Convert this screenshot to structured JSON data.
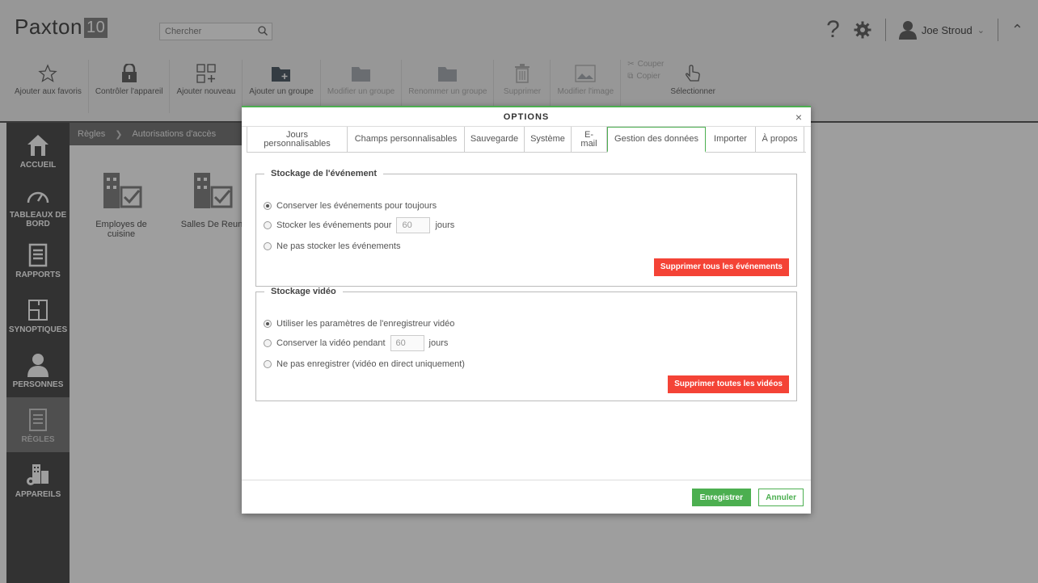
{
  "header": {
    "logo_text": "Paxton",
    "logo_number": "10",
    "search_placeholder": "Chercher",
    "user_name": "Joe Stroud"
  },
  "toolbar": {
    "items": [
      {
        "label": "Ajouter aux favoris",
        "icon": "star-icon",
        "enabled": true
      },
      {
        "label": "Contrôler l'appareil",
        "icon": "lock-icon",
        "enabled": true
      },
      {
        "label": "Ajouter nouveau",
        "icon": "add-grid-icon",
        "enabled": true
      },
      {
        "label": "Ajouter un groupe",
        "icon": "add-folder-icon",
        "enabled": true
      },
      {
        "label": "Modifier un groupe",
        "icon": "edit-folder-icon",
        "enabled": false
      },
      {
        "label": "Renommer un groupe",
        "icon": "rename-folder-icon",
        "enabled": false
      },
      {
        "label": "Supprimer",
        "icon": "trash-icon",
        "enabled": false
      },
      {
        "label": "Modifier l'image",
        "icon": "image-icon",
        "enabled": false
      }
    ],
    "cut_label": "Couper",
    "copy_label": "Copier",
    "select_label": "Sélectionner"
  },
  "sidebar": {
    "items": [
      {
        "label": "ACCUEIL",
        "icon": "home-icon"
      },
      {
        "label": "TABLEAUX DE BORD",
        "icon": "dashboard-icon"
      },
      {
        "label": "RAPPORTS",
        "icon": "reports-icon"
      },
      {
        "label": "SYNOPTIQUES",
        "icon": "floorplan-icon"
      },
      {
        "label": "PERSONNES",
        "icon": "person-icon"
      },
      {
        "label": "RÈGLES",
        "icon": "rules-icon",
        "active": true
      },
      {
        "label": "APPAREILS",
        "icon": "devices-icon"
      }
    ]
  },
  "content": {
    "breadcrumb": [
      "Règles",
      "Autorisations d'accès"
    ],
    "tiles": [
      "Employes de cuisine",
      "Salles De Reun"
    ]
  },
  "dialog": {
    "title": "OPTIONS",
    "close": "×",
    "tabs": [
      {
        "label": "Jours personnalisables",
        "active": false
      },
      {
        "label": "Champs personnalisables",
        "active": false
      },
      {
        "label": "Sauvegarde",
        "active": false
      },
      {
        "label": "Système",
        "active": false
      },
      {
        "label": "E-mail",
        "active": false
      },
      {
        "label": "Gestion des données",
        "active": true
      },
      {
        "label": "Importer",
        "active": false
      },
      {
        "label": "À propos",
        "active": false
      }
    ],
    "events": {
      "legend": "Stockage de l'événement",
      "options": [
        {
          "label": "Conserver les événements pour toujours",
          "checked": true
        },
        {
          "label": "Stocker les événements pour",
          "checked": false,
          "value": "60",
          "unit": "jours"
        },
        {
          "label": "Ne pas stocker les événements",
          "checked": false
        }
      ],
      "delete_button": "Supprimer tous les événements"
    },
    "video": {
      "legend": "Stockage vidéo",
      "options": [
        {
          "label": "Utiliser les paramètres de l'enregistreur vidéo",
          "checked": true
        },
        {
          "label": "Conserver la vidéo pendant",
          "checked": false,
          "value": "60",
          "unit": "jours"
        },
        {
          "label": "Ne pas enregistrer (vidéo en direct uniquement)",
          "checked": false
        }
      ],
      "delete_button": "Supprimer toutes les vidéos"
    },
    "save_button": "Enregistrer",
    "cancel_button": "Annuler"
  },
  "colors": {
    "accent": "#4caf50",
    "danger": "#f44336",
    "sidebar": "#3b3b3b"
  }
}
